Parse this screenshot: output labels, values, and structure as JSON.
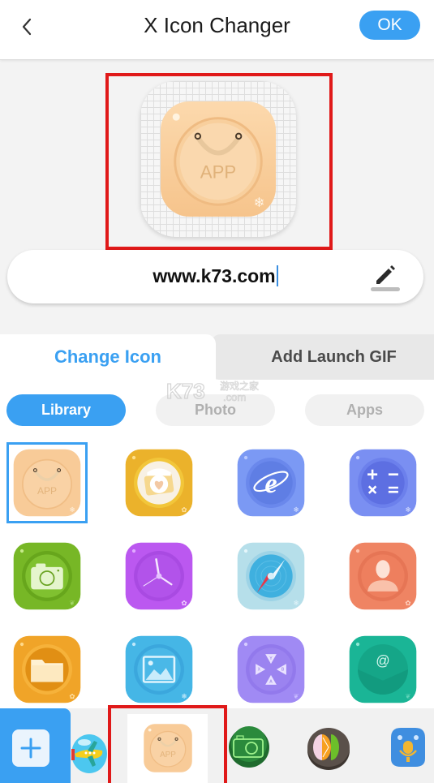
{
  "header": {
    "back_icon": "chevron-left-icon",
    "title": "X Icon Changer",
    "ok_label": "OK"
  },
  "preview": {
    "icon": "app-store-bag-icon",
    "icon_text": "APP",
    "badge": "snowflake"
  },
  "name_input": {
    "value": "www.k73.com",
    "edit_icon": "pencil-icon"
  },
  "tabs": [
    {
      "label": "Change Icon",
      "active": true
    },
    {
      "label": "Add Launch GIF",
      "active": false
    }
  ],
  "subtabs": [
    {
      "label": "Library",
      "active": true
    },
    {
      "label": "Photo",
      "active": false
    },
    {
      "label": "Apps",
      "active": false
    }
  ],
  "watermark": {
    "logo": "K73",
    "cn": "游戏之家",
    "domain": ".com"
  },
  "library_icons": [
    {
      "name": "app-store-icon",
      "label_text": "APP",
      "color": "#f7c994",
      "selected": true
    },
    {
      "name": "camera-heart-icon",
      "color": "#eab12a",
      "selected": false
    },
    {
      "name": "browser-ie-icon",
      "color": "#6f8ff0",
      "selected": false
    },
    {
      "name": "calculator-icon",
      "color": "#6a82ee",
      "selected": false
    },
    {
      "name": "camera-icon",
      "color": "#74b524",
      "selected": false
    },
    {
      "name": "clock-icon",
      "color": "#b44ee8",
      "selected": false
    },
    {
      "name": "compass-icon",
      "color": "#a8d8e6",
      "selected": false
    },
    {
      "name": "contacts-icon",
      "color": "#ee7f5c",
      "selected": false
    },
    {
      "name": "folder-icon",
      "color": "#eea024",
      "selected": false
    },
    {
      "name": "gallery-icon",
      "color": "#3fb4e4",
      "selected": false
    },
    {
      "name": "gamepad-icon",
      "color": "#9d86f2",
      "selected": false
    },
    {
      "name": "email-icon",
      "color": "#19b394",
      "selected": false
    }
  ],
  "bottom_bar": {
    "add_icon": "plus-icon",
    "recent_icons": [
      {
        "name": "airplane-bubble-icon",
        "selected": false
      },
      {
        "name": "app-store-icon",
        "label_text": "APP",
        "selected": true
      },
      {
        "name": "green-camera-icon",
        "selected": false
      },
      {
        "name": "fruit-slices-icon",
        "selected": false
      },
      {
        "name": "bird-microphone-icon",
        "selected": false
      }
    ]
  }
}
